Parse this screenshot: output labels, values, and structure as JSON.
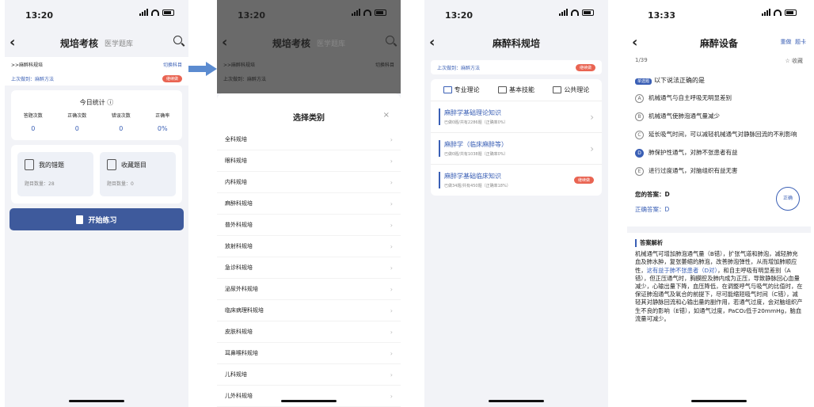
{
  "p1": {
    "time": "13:20",
    "nav_title": "规培考核",
    "nav_sub": "医学题库",
    "course": ">>麻醉科规培",
    "switch": "切换科目",
    "last_done": "上次做到：麻醉方法",
    "tag": "继续做",
    "stats_title": "今日统计 ⓘ",
    "stats": [
      {
        "label": "答题次数",
        "value": "0"
      },
      {
        "label": "正确次数",
        "value": "0"
      },
      {
        "label": "错误次数",
        "value": "0"
      },
      {
        "label": "正确率",
        "value": "0%"
      }
    ],
    "wrong_title": "我的错题",
    "wrong_count": "题目数量：28",
    "fav_title": "收藏题目",
    "fav_count": "题目数量：0",
    "start": "开始练习"
  },
  "p2": {
    "time": "13:20",
    "nav_title": "规培考核",
    "nav_sub": "医学题库",
    "course": ">>麻醉科规培",
    "switch": "切换科目",
    "last_done": "上次做到：麻醉方法",
    "sheet_title": "选择类别",
    "close": "×",
    "options": [
      "全科规培",
      "眼科规培",
      "内科规培",
      "麻醉科规培",
      "普外科规培",
      "放射科规培",
      "急诊科规培",
      "泌尿外科规培",
      "临床病理科规培",
      "皮肤科规培",
      "耳鼻喉科规培",
      "儿科规培",
      "儿外科规培"
    ]
  },
  "p3": {
    "time": "13:20",
    "nav_title": "麻醉科规培",
    "last_done": "上次做到：麻醉方法",
    "tag": "继续做",
    "tabs": [
      "专业理论",
      "基本技能",
      "公共理论"
    ],
    "cats": [
      {
        "name": "麻醉学基础理论知识",
        "meta": "已做0题/共有2286题（正确率0%）",
        "tag": ""
      },
      {
        "name": "麻醉学（临床麻醉等）",
        "meta": "已做0题/共有1038题（正确率0%）",
        "tag": ""
      },
      {
        "name": "麻醉学基础临床知识",
        "meta": "已做34题/共有450题（正确率18%）",
        "tag": "继续做"
      }
    ]
  },
  "p4": {
    "time": "13:33",
    "nav_title": "麻醉设备",
    "reset": "重做",
    "card": "题卡",
    "progress": "1/39",
    "fav": "☆ 收藏",
    "qtype": "单选题",
    "question": "以下说法正确的是",
    "choices": [
      {
        "key": "A",
        "text": "机械通气与自主呼吸无明显差别"
      },
      {
        "key": "B",
        "text": "机械通气使肺泡通气量减少"
      },
      {
        "key": "C",
        "text": "延长吸气时间，可以减轻机械通气对静脉回流的不利影响"
      },
      {
        "key": "D",
        "text": "肺保护性通气，对肺不张患者有益"
      },
      {
        "key": "E",
        "text": "进行过度通气，对脑组织有益无害"
      }
    ],
    "your_answer": "您的答案：D",
    "correct_answer": "正确答案：D",
    "stamp": "正确",
    "expl_title": "答案解析",
    "expl_a": "机械通气可增加肺泡通气量（B错），扩张气道和肺泡，减轻肺充血及肺水肿，复张萎缩的肺泡，改善肺泡弹性，从而增加肺顺应性，",
    "expl_hl": "这有益于肺不张患者（D对）",
    "expl_b": "，和自主呼吸有明显差别（A错），但正压通气时，胸膜腔及肺内成为正压，导致静脉回心血量减少，心输出量下降，血压降低，在调整呼气与吸气的比值时，在保证肺泡通气及氧合的前提下，尽可能缩短吸气时间（C错），减轻其对静脉回流和心输出量的副作用，若通气过度，会对脑组织产生不良的影响（E错），如通气过度，PaCO₂低于20mmHg，脑血流量可减少。"
  }
}
